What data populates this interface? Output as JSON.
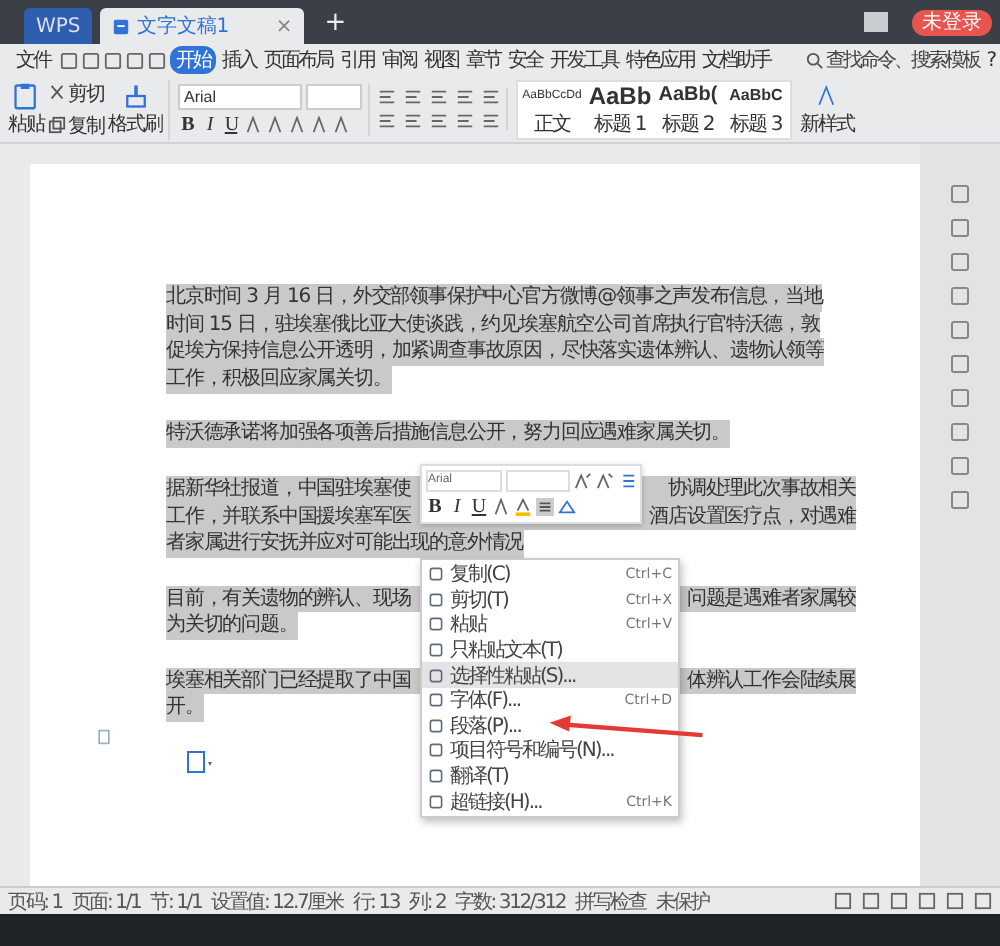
{
  "title_bar": {
    "tabs": [
      {
        "label": "WPS",
        "selected": false,
        "kind": "home"
      },
      {
        "label": "文字文稿1",
        "selected": true,
        "kind": "document"
      }
    ],
    "close_tab": "×",
    "new_tab": "+",
    "account_badge": "未登录"
  },
  "menu_bar": {
    "file": "文件",
    "tabs": [
      {
        "label": "开始",
        "selected": true
      },
      {
        "label": "插入",
        "selected": false
      },
      {
        "label": "页面布局",
        "selected": false
      },
      {
        "label": "引用",
        "selected": false
      },
      {
        "label": "审阅",
        "selected": false
      },
      {
        "label": "视图",
        "selected": false
      },
      {
        "label": "章节",
        "selected": false
      },
      {
        "label": "安全",
        "selected": false
      },
      {
        "label": "开发工具",
        "selected": false
      },
      {
        "label": "特色应用",
        "selected": false
      },
      {
        "label": "文档助手",
        "selected": false
      }
    ],
    "search": {
      "placeholder": "查找命令、搜索模板"
    },
    "help": "?"
  },
  "ribbon": {
    "paste": "粘贴",
    "cut": "剪切",
    "copy": "复制",
    "format_painter": "格式刷",
    "font_name": "Arial",
    "bold": "B",
    "italic": "I",
    "underline": "U",
    "styles": [
      {
        "sample": "AaBbCcDd",
        "label": "正文"
      },
      {
        "sample": "AaBb",
        "label": "标题 1"
      },
      {
        "sample": "AaBb(",
        "label": "标题 2"
      },
      {
        "sample": "AaBbC",
        "label": "标题 3"
      }
    ],
    "new_style": "新样式"
  },
  "document": {
    "paragraphs": [
      {
        "selected": true,
        "lines": [
          [
            "北京时间 3 月 16 日，外交部领事保护中心官方微博@领事之声发布信息，当地"
          ],
          [
            "时间 15 日，驻埃塞俄比亚大使谈践，约见埃塞航空公司首席执行官特沃德，敦"
          ],
          [
            "促埃方保持信息公开透明，加紧调查事故原因，尽快落实遗体辨认、遗物认领等"
          ],
          [
            "工作，积极回应家属关切。"
          ]
        ]
      },
      {
        "selected": true,
        "lines": [
          [
            "特沃德承诺将加强各项善后措施信息公开，努力回应遇难家属关切。"
          ]
        ]
      },
      {
        "selected": true,
        "lines": [
          [
            "据新华社报道，中国驻埃塞使",
            "协调处理此次事故相关"
          ],
          [
            "工作，并联系中国援埃塞军医",
            "酒店设置医疗点，对遇难"
          ],
          [
            "者家属进行安抚并应对可能出现的意外情况"
          ]
        ]
      },
      {
        "selected": true,
        "lines": [
          [
            "目前，有关遗物的辨认、现场",
            "问题是遇难者家属较"
          ],
          [
            "为关切的问题。"
          ]
        ]
      },
      {
        "selected": true,
        "lines": [
          [
            "埃塞相关部门已经提取了中国",
            "体辨认工作会陆续展"
          ],
          [
            "开。"
          ]
        ]
      }
    ]
  },
  "mini_toolbar": {
    "font_name": "Arial",
    "bold": "B",
    "italic": "I",
    "underline": "U"
  },
  "context_menu": {
    "items": [
      {
        "label": "复制(C)",
        "shortcut": "Ctrl+C",
        "highlighted": false
      },
      {
        "label": "剪切(T)",
        "shortcut": "Ctrl+X",
        "highlighted": false
      },
      {
        "label": "粘贴",
        "shortcut": "Ctrl+V",
        "highlighted": false
      },
      {
        "label": "只粘贴文本(T)",
        "highlighted": false
      },
      {
        "label": "选择性粘贴(S)...",
        "highlighted": true
      },
      {
        "label": "字体(F)...",
        "shortcut": "Ctrl+D",
        "highlighted": false
      },
      {
        "label": "段落(P)...",
        "highlighted": false
      },
      {
        "label": "项目符号和编号(N)...",
        "highlighted": false
      },
      {
        "label": "翻译(T)",
        "highlighted": false
      },
      {
        "label": "超链接(H)...",
        "shortcut": "Ctrl+K",
        "highlighted": false
      }
    ]
  },
  "status_bar": {
    "items": [
      "页码: 1",
      "页面: 1/1",
      "节: 1/1",
      "设置值: 12.7厘米",
      "行: 13",
      "列: 2",
      "字数: 312/312",
      "拼写检查",
      "未保护"
    ]
  }
}
